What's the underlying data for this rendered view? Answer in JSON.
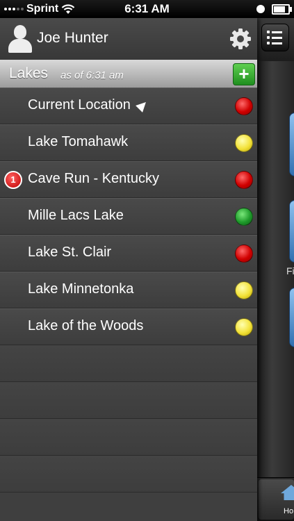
{
  "statusbar": {
    "carrier": "Sprint",
    "time": "6:31 AM"
  },
  "profile": {
    "name": "Joe Hunter"
  },
  "section": {
    "title": "Lakes",
    "subtitle": "as of 6:31 am",
    "add_label": "+"
  },
  "lakes": [
    {
      "label": "Current Location",
      "status": "red",
      "location_icon": true,
      "badge": ""
    },
    {
      "label": "Lake Tomahawk",
      "status": "yellow",
      "badge": ""
    },
    {
      "label": "Cave Run - Kentucky",
      "status": "red",
      "badge": "1"
    },
    {
      "label": "Mille Lacs Lake",
      "status": "green",
      "badge": ""
    },
    {
      "label": "Lake St. Clair",
      "status": "red",
      "badge": ""
    },
    {
      "label": "Lake Minnetonka",
      "status": "yellow",
      "badge": ""
    },
    {
      "label": "Lake of the Woods",
      "status": "yellow",
      "badge": ""
    }
  ],
  "right_panel": {
    "snippet": "Fi",
    "tab_label": "Ho"
  },
  "colors": {
    "red": "#d00000",
    "yellow": "#f3e23a",
    "green": "#1e9a2a",
    "add_button": "#2fa82f"
  }
}
